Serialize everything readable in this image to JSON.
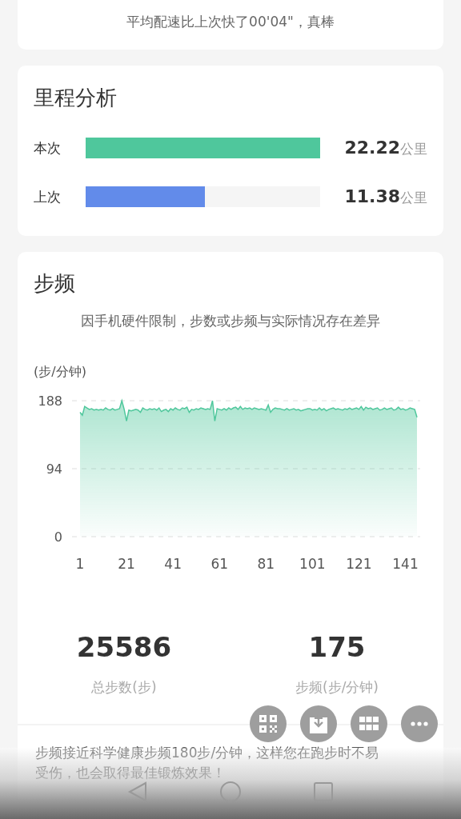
{
  "summary_card": {
    "message": "平均配速比上次快了00'04\"，真棒"
  },
  "mileage": {
    "title": "里程分析",
    "rows": [
      {
        "label": "本次",
        "level": 1.0,
        "color": "#4fc79c",
        "value": "22.22",
        "unit": "公里"
      },
      {
        "label": "上次",
        "level": 0.51,
        "color": "#628bea",
        "value": "11.38",
        "unit": "公里"
      }
    ]
  },
  "cadence": {
    "title": "步频",
    "note": "因手机硬件限制，步数或步频与实际情况存在差异",
    "chart_data": {
      "type": "area",
      "ylabel": "(步/分钟)",
      "x": [
        1,
        2,
        3,
        4,
        5,
        6,
        7,
        8,
        9,
        10,
        11,
        12,
        13,
        14,
        15,
        16,
        17,
        18,
        19,
        20,
        21,
        22,
        23,
        24,
        25,
        26,
        27,
        28,
        29,
        30,
        31,
        32,
        33,
        34,
        35,
        36,
        37,
        38,
        39,
        40,
        41,
        42,
        43,
        44,
        45,
        46,
        47,
        48,
        49,
        50,
        51,
        52,
        53,
        54,
        55,
        56,
        57,
        58,
        59,
        60,
        61,
        62,
        63,
        64,
        65,
        66,
        67,
        68,
        69,
        70,
        71,
        72,
        73,
        74,
        75,
        76,
        77,
        78,
        79,
        80,
        81,
        82,
        83,
        84,
        85,
        86,
        87,
        88,
        89,
        90,
        91,
        92,
        93,
        94,
        95,
        96,
        97,
        98,
        99,
        100,
        101,
        102,
        103,
        104,
        105,
        106,
        107,
        108,
        109,
        110,
        111,
        112,
        113,
        114,
        115,
        116,
        117,
        118,
        119,
        120,
        121,
        122,
        123,
        124,
        125,
        126,
        127,
        128,
        129,
        130,
        131,
        132,
        133,
        134,
        135,
        136,
        137,
        138,
        139,
        140,
        141,
        142,
        143,
        144,
        145,
        146
      ],
      "xlim": [
        1,
        146
      ],
      "ylim": [
        0,
        188
      ],
      "xticks": [
        {
          "value": 1,
          "label": "1"
        },
        {
          "value": 21,
          "label": "21"
        },
        {
          "value": 41,
          "label": "41"
        },
        {
          "value": 61,
          "label": "61"
        },
        {
          "value": 81,
          "label": "81"
        },
        {
          "value": 101,
          "label": "101"
        },
        {
          "value": 121,
          "label": "121"
        },
        {
          "value": 141,
          "label": "141"
        }
      ],
      "yticks": [
        0,
        94,
        188
      ],
      "series": [
        {
          "color": "#4fc79c",
          "values": [
            172,
            168,
            180,
            178,
            176,
            177,
            175,
            176,
            175,
            176,
            175,
            178,
            176,
            175,
            177,
            175,
            176,
            177,
            188,
            176,
            160,
            175,
            174,
            175,
            176,
            175,
            172,
            178,
            176,
            175,
            177,
            176,
            177,
            175,
            178,
            173,
            175,
            176,
            173,
            177,
            175,
            178,
            176,
            175,
            178,
            177,
            179,
            172,
            176,
            175,
            177,
            176,
            178,
            177,
            176,
            177,
            176,
            188,
            160,
            177,
            176,
            175,
            177,
            175,
            178,
            176,
            178,
            179,
            176,
            180,
            176,
            178,
            177,
            178,
            176,
            178,
            177,
            176,
            177,
            176,
            175,
            182,
            172,
            176,
            178,
            177,
            177,
            176,
            175,
            177,
            175,
            176,
            177,
            175,
            176,
            174,
            175,
            176,
            177,
            177,
            175,
            176,
            175,
            178,
            175,
            177,
            174,
            176,
            177,
            178,
            176,
            177,
            176,
            175,
            177,
            176,
            178,
            176,
            177,
            178,
            176,
            180,
            175,
            179,
            177,
            178,
            176,
            177,
            178,
            175,
            176,
            178,
            176,
            177,
            178,
            175,
            176,
            179,
            176,
            177,
            175,
            176,
            178,
            177,
            176,
            165
          ]
        }
      ]
    },
    "stats": [
      {
        "value": "25586",
        "label": "总步数(步)"
      },
      {
        "value": "175",
        "label": "步频(步/分钟)"
      }
    ],
    "tip": "步频接近科学健康步频180步/分钟，这样您在跑步时不易受伤，也会取得最佳锻炼效果！"
  }
}
